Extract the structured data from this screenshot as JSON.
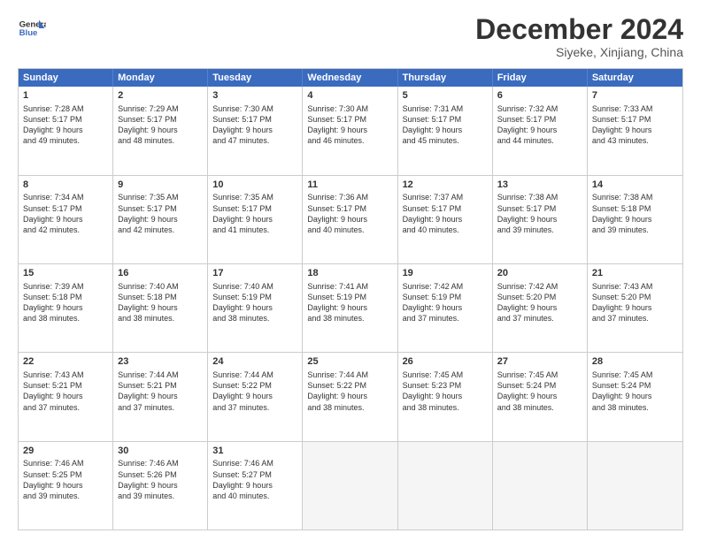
{
  "logo": {
    "text_general": "General",
    "text_blue": "Blue"
  },
  "header": {
    "month": "December 2024",
    "location": "Siyeke, Xinjiang, China"
  },
  "weekdays": [
    "Sunday",
    "Monday",
    "Tuesday",
    "Wednesday",
    "Thursday",
    "Friday",
    "Saturday"
  ],
  "weeks": [
    [
      {
        "day": "1",
        "lines": [
          "Sunrise: 7:28 AM",
          "Sunset: 5:17 PM",
          "Daylight: 9 hours",
          "and 49 minutes."
        ]
      },
      {
        "day": "2",
        "lines": [
          "Sunrise: 7:29 AM",
          "Sunset: 5:17 PM",
          "Daylight: 9 hours",
          "and 48 minutes."
        ]
      },
      {
        "day": "3",
        "lines": [
          "Sunrise: 7:30 AM",
          "Sunset: 5:17 PM",
          "Daylight: 9 hours",
          "and 47 minutes."
        ]
      },
      {
        "day": "4",
        "lines": [
          "Sunrise: 7:30 AM",
          "Sunset: 5:17 PM",
          "Daylight: 9 hours",
          "and 46 minutes."
        ]
      },
      {
        "day": "5",
        "lines": [
          "Sunrise: 7:31 AM",
          "Sunset: 5:17 PM",
          "Daylight: 9 hours",
          "and 45 minutes."
        ]
      },
      {
        "day": "6",
        "lines": [
          "Sunrise: 7:32 AM",
          "Sunset: 5:17 PM",
          "Daylight: 9 hours",
          "and 44 minutes."
        ]
      },
      {
        "day": "7",
        "lines": [
          "Sunrise: 7:33 AM",
          "Sunset: 5:17 PM",
          "Daylight: 9 hours",
          "and 43 minutes."
        ]
      }
    ],
    [
      {
        "day": "8",
        "lines": [
          "Sunrise: 7:34 AM",
          "Sunset: 5:17 PM",
          "Daylight: 9 hours",
          "and 42 minutes."
        ]
      },
      {
        "day": "9",
        "lines": [
          "Sunrise: 7:35 AM",
          "Sunset: 5:17 PM",
          "Daylight: 9 hours",
          "and 42 minutes."
        ]
      },
      {
        "day": "10",
        "lines": [
          "Sunrise: 7:35 AM",
          "Sunset: 5:17 PM",
          "Daylight: 9 hours",
          "and 41 minutes."
        ]
      },
      {
        "day": "11",
        "lines": [
          "Sunrise: 7:36 AM",
          "Sunset: 5:17 PM",
          "Daylight: 9 hours",
          "and 40 minutes."
        ]
      },
      {
        "day": "12",
        "lines": [
          "Sunrise: 7:37 AM",
          "Sunset: 5:17 PM",
          "Daylight: 9 hours",
          "and 40 minutes."
        ]
      },
      {
        "day": "13",
        "lines": [
          "Sunrise: 7:38 AM",
          "Sunset: 5:17 PM",
          "Daylight: 9 hours",
          "and 39 minutes."
        ]
      },
      {
        "day": "14",
        "lines": [
          "Sunrise: 7:38 AM",
          "Sunset: 5:18 PM",
          "Daylight: 9 hours",
          "and 39 minutes."
        ]
      }
    ],
    [
      {
        "day": "15",
        "lines": [
          "Sunrise: 7:39 AM",
          "Sunset: 5:18 PM",
          "Daylight: 9 hours",
          "and 38 minutes."
        ]
      },
      {
        "day": "16",
        "lines": [
          "Sunrise: 7:40 AM",
          "Sunset: 5:18 PM",
          "Daylight: 9 hours",
          "and 38 minutes."
        ]
      },
      {
        "day": "17",
        "lines": [
          "Sunrise: 7:40 AM",
          "Sunset: 5:19 PM",
          "Daylight: 9 hours",
          "and 38 minutes."
        ]
      },
      {
        "day": "18",
        "lines": [
          "Sunrise: 7:41 AM",
          "Sunset: 5:19 PM",
          "Daylight: 9 hours",
          "and 38 minutes."
        ]
      },
      {
        "day": "19",
        "lines": [
          "Sunrise: 7:42 AM",
          "Sunset: 5:19 PM",
          "Daylight: 9 hours",
          "and 37 minutes."
        ]
      },
      {
        "day": "20",
        "lines": [
          "Sunrise: 7:42 AM",
          "Sunset: 5:20 PM",
          "Daylight: 9 hours",
          "and 37 minutes."
        ]
      },
      {
        "day": "21",
        "lines": [
          "Sunrise: 7:43 AM",
          "Sunset: 5:20 PM",
          "Daylight: 9 hours",
          "and 37 minutes."
        ]
      }
    ],
    [
      {
        "day": "22",
        "lines": [
          "Sunrise: 7:43 AM",
          "Sunset: 5:21 PM",
          "Daylight: 9 hours",
          "and 37 minutes."
        ]
      },
      {
        "day": "23",
        "lines": [
          "Sunrise: 7:44 AM",
          "Sunset: 5:21 PM",
          "Daylight: 9 hours",
          "and 37 minutes."
        ]
      },
      {
        "day": "24",
        "lines": [
          "Sunrise: 7:44 AM",
          "Sunset: 5:22 PM",
          "Daylight: 9 hours",
          "and 37 minutes."
        ]
      },
      {
        "day": "25",
        "lines": [
          "Sunrise: 7:44 AM",
          "Sunset: 5:22 PM",
          "Daylight: 9 hours",
          "and 38 minutes."
        ]
      },
      {
        "day": "26",
        "lines": [
          "Sunrise: 7:45 AM",
          "Sunset: 5:23 PM",
          "Daylight: 9 hours",
          "and 38 minutes."
        ]
      },
      {
        "day": "27",
        "lines": [
          "Sunrise: 7:45 AM",
          "Sunset: 5:24 PM",
          "Daylight: 9 hours",
          "and 38 minutes."
        ]
      },
      {
        "day": "28",
        "lines": [
          "Sunrise: 7:45 AM",
          "Sunset: 5:24 PM",
          "Daylight: 9 hours",
          "and 38 minutes."
        ]
      }
    ],
    [
      {
        "day": "29",
        "lines": [
          "Sunrise: 7:46 AM",
          "Sunset: 5:25 PM",
          "Daylight: 9 hours",
          "and 39 minutes."
        ]
      },
      {
        "day": "30",
        "lines": [
          "Sunrise: 7:46 AM",
          "Sunset: 5:26 PM",
          "Daylight: 9 hours",
          "and 39 minutes."
        ]
      },
      {
        "day": "31",
        "lines": [
          "Sunrise: 7:46 AM",
          "Sunset: 5:27 PM",
          "Daylight: 9 hours",
          "and 40 minutes."
        ]
      },
      {
        "day": "",
        "lines": []
      },
      {
        "day": "",
        "lines": []
      },
      {
        "day": "",
        "lines": []
      },
      {
        "day": "",
        "lines": []
      }
    ]
  ]
}
